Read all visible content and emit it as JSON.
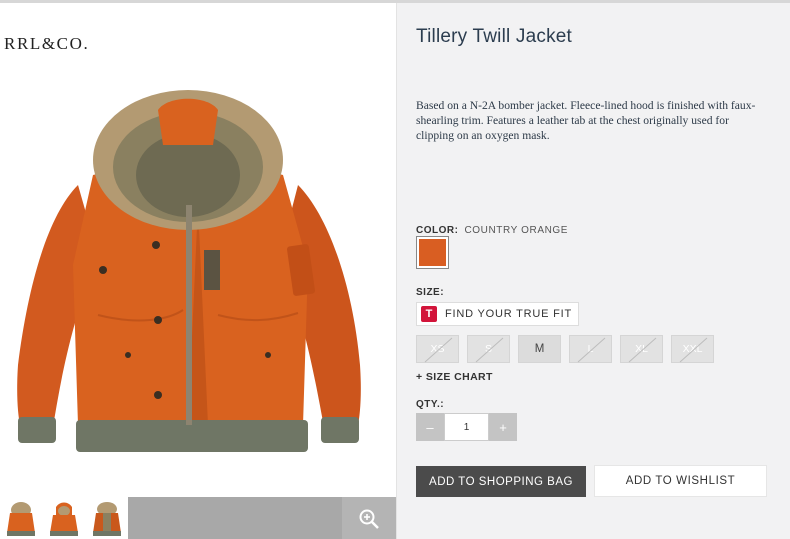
{
  "brand": "RRL&CO.",
  "product": {
    "title": "Tillery Twill Jacket",
    "description": "Based on a N-2A bomber jacket. Fleece-lined hood is finished with faux-shearling trim. Features a leather tab at the chest originally used for clipping on an oxygen mask.",
    "image_icon": "orange-hooded-bomber-jacket"
  },
  "gallery": {
    "thumbnails": [
      "jacket-front-thumbnail",
      "jacket-hood-up-thumbnail",
      "jacket-back-thumbnail"
    ],
    "zoom_icon": "magnifier-plus-icon"
  },
  "color": {
    "label": "COLOR:",
    "value": "COUNTRY ORANGE",
    "swatch_hex": "#d95e22"
  },
  "size": {
    "label": "SIZE:",
    "fit_badge": "T",
    "fit_label": "FIND YOUR TRUE FIT",
    "options": [
      {
        "label": "XS",
        "available": false
      },
      {
        "label": "S",
        "available": false
      },
      {
        "label": "M",
        "available": true
      },
      {
        "label": "L",
        "available": false
      },
      {
        "label": "XL",
        "available": false
      },
      {
        "label": "XXL",
        "available": false
      }
    ],
    "chart_link": "+ SIZE CHART"
  },
  "quantity": {
    "label": "QTY.:",
    "minus": "–",
    "value": "1",
    "plus": "+"
  },
  "actions": {
    "add_to_bag": "ADD TO SHOPPING BAG",
    "add_to_wishlist": "ADD TO WISHLIST"
  },
  "colors": {
    "accent_orange": "#d95e22",
    "title_navy": "#2c3d4f",
    "bag_button": "#4b4b4b",
    "truefit_red": "#d2143a"
  }
}
